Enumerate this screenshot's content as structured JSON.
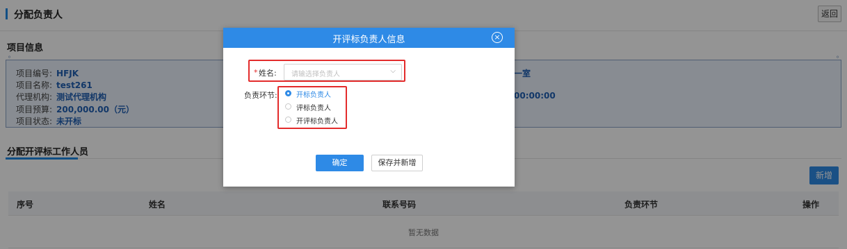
{
  "page": {
    "title": "分配负责人",
    "back_label": "返回",
    "project_section_title": "项目信息",
    "project_info": [
      {
        "label": "项目编号:",
        "value": "HFJK"
      },
      {
        "label": "项目名称:",
        "value": "test261"
      },
      {
        "label": "代理机构:",
        "value": "测试代理机构"
      },
      {
        "label": "项目预算:",
        "value": "200,000.00（元）"
      },
      {
        "label": "项目状态:",
        "value": "未开标"
      }
    ],
    "project_info_right": [
      "一室",
      "00:00:00"
    ],
    "staff_tab_title": "分配开评标工作人员",
    "add_label": "新增",
    "table": {
      "columns": [
        "序号",
        "姓名",
        "联系号码",
        "负责环节",
        "操作"
      ],
      "empty_text": "暂无数据"
    }
  },
  "dialog": {
    "title": "开评标负责人信息",
    "close_glyph": "×",
    "required_mark": "*",
    "name_label": "姓名:",
    "name_placeholder": "请输选择负责人",
    "chevron_glyph": "⌵",
    "stage_label": "负责环节:",
    "stage_options": [
      {
        "label": "开标负责人",
        "checked": true
      },
      {
        "label": "评标负责人",
        "checked": false
      },
      {
        "label": "开评标负责人",
        "checked": false
      }
    ],
    "confirm_label": "确定",
    "save_new_label": "保存并新增"
  },
  "colors": {
    "accent": "#2e8ae6",
    "highlight": "#e32b2b",
    "info_bg": "#eaf1fb",
    "info_value": "#1f5fb3"
  }
}
